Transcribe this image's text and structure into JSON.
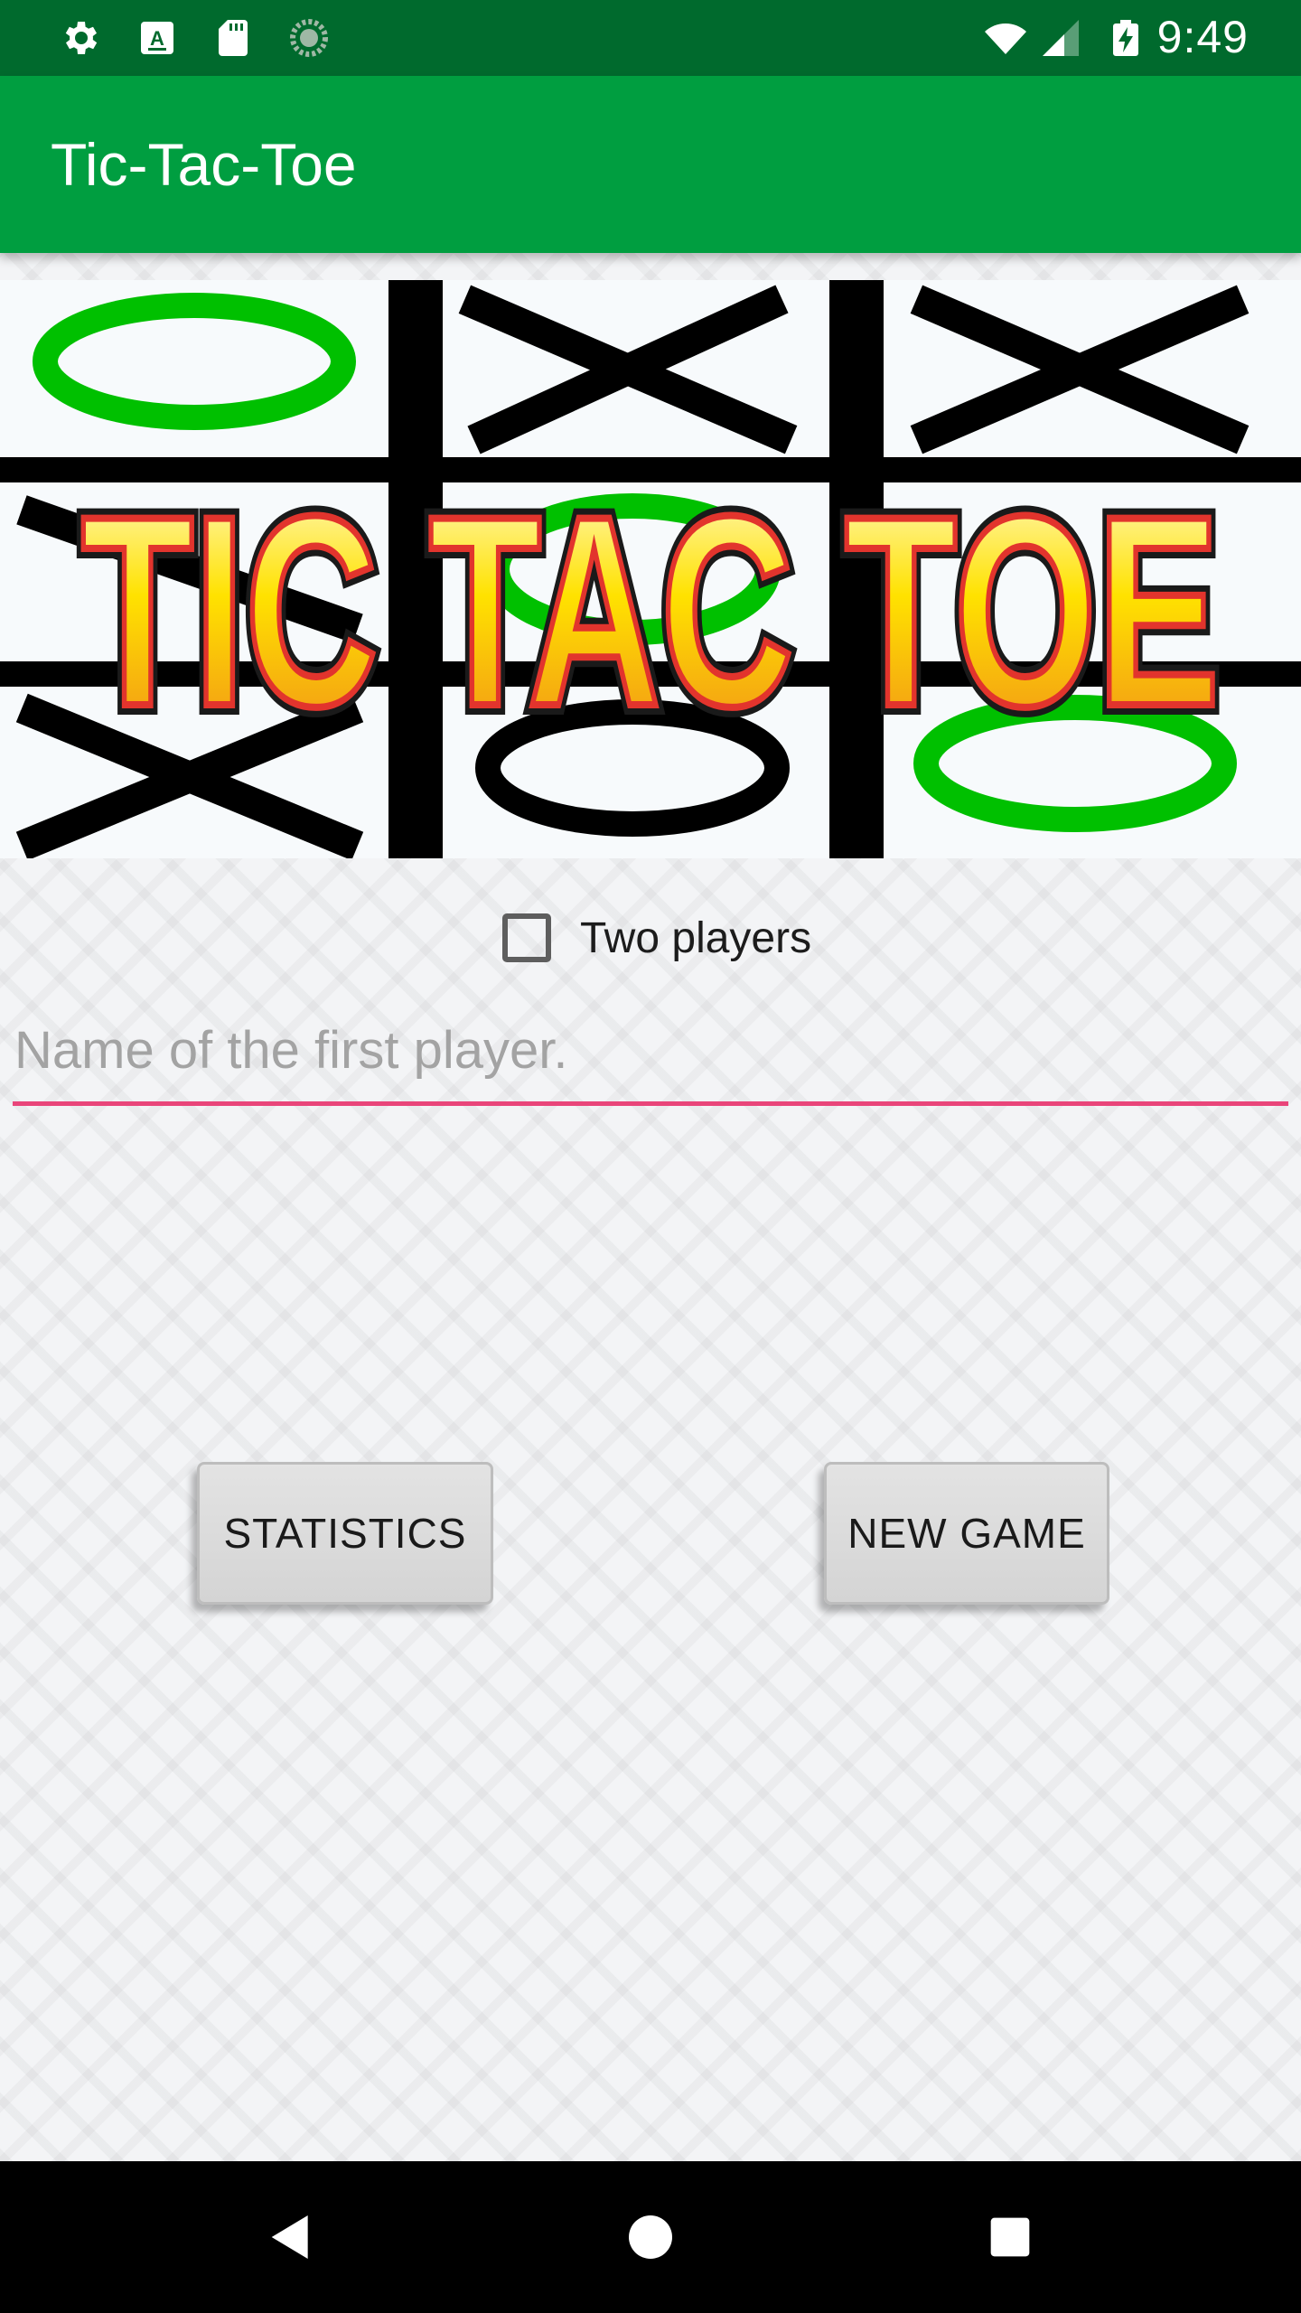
{
  "status_bar": {
    "time": "9:49",
    "icons": [
      "settings-icon",
      "a-keyboard-icon",
      "sd-card-icon",
      "sync-icon",
      "wifi-icon",
      "signal-icon",
      "battery-charging-icon"
    ]
  },
  "app_bar": {
    "title": "Tic-Tac-Toe"
  },
  "banner": {
    "logo_text": "TIC TAC TOE",
    "colors": {
      "green": "#00c000",
      "black": "#000000",
      "yellow": "#ffd400",
      "orange": "#f39a1d",
      "red_outline": "#e2342d"
    }
  },
  "options": {
    "two_players_label": "Two players",
    "two_players_checked": false
  },
  "first_player": {
    "value": "",
    "placeholder": "Name of the first player."
  },
  "buttons": {
    "statistics": "STATISTICS",
    "new_game": "NEW GAME"
  },
  "nav_bar": {
    "icons": [
      "back-icon",
      "home-icon",
      "recents-icon"
    ]
  },
  "colors": {
    "status_bar": "#006a2d",
    "app_bar": "#009e40",
    "input_underline": "#e9457a"
  }
}
